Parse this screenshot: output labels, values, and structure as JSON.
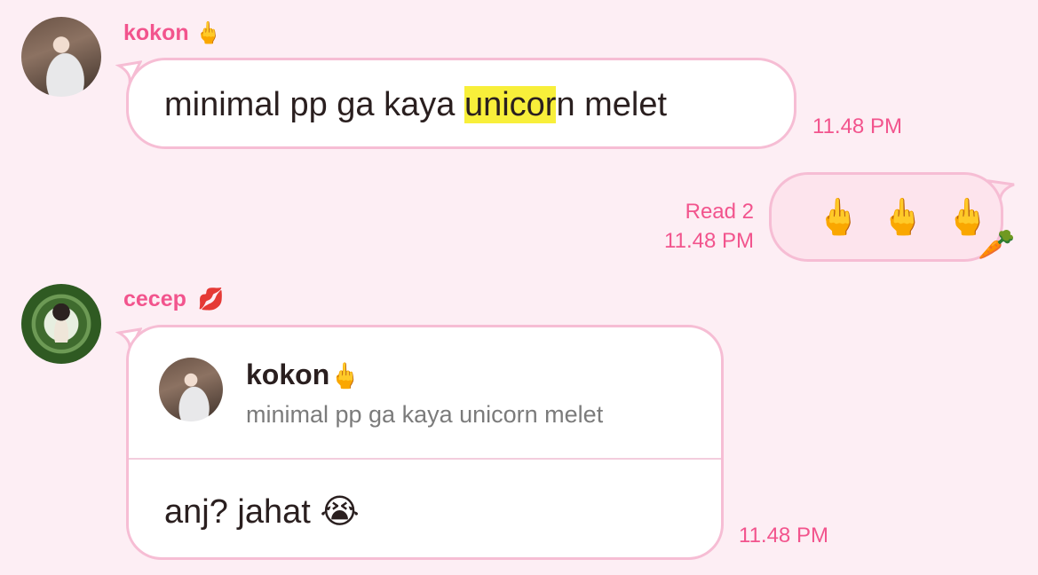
{
  "messages": [
    {
      "sender": "kokon",
      "sender_emoji": "🖕",
      "text_before": "minimal pp ga kaya ",
      "text_highlight": "unicor",
      "text_after": "n melet",
      "time": "11.48 PM"
    },
    {
      "sender": "me",
      "text": "🖕 🖕 🖕",
      "read_status": "Read 2",
      "time": "11.48 PM",
      "sticker": "🥕"
    },
    {
      "sender": "cecep",
      "sender_emoji": "💋",
      "quote": {
        "name": "kokon",
        "name_emoji": "🖕",
        "text": "minimal pp ga kaya unicorn melet"
      },
      "text": "anj? jahat 😭",
      "time": "11.48 PM"
    }
  ],
  "colors": {
    "background": "#fdeef4",
    "accent": "#f2548d",
    "bubble_border": "#f6bdd4",
    "highlight": "#f8ef3a"
  }
}
